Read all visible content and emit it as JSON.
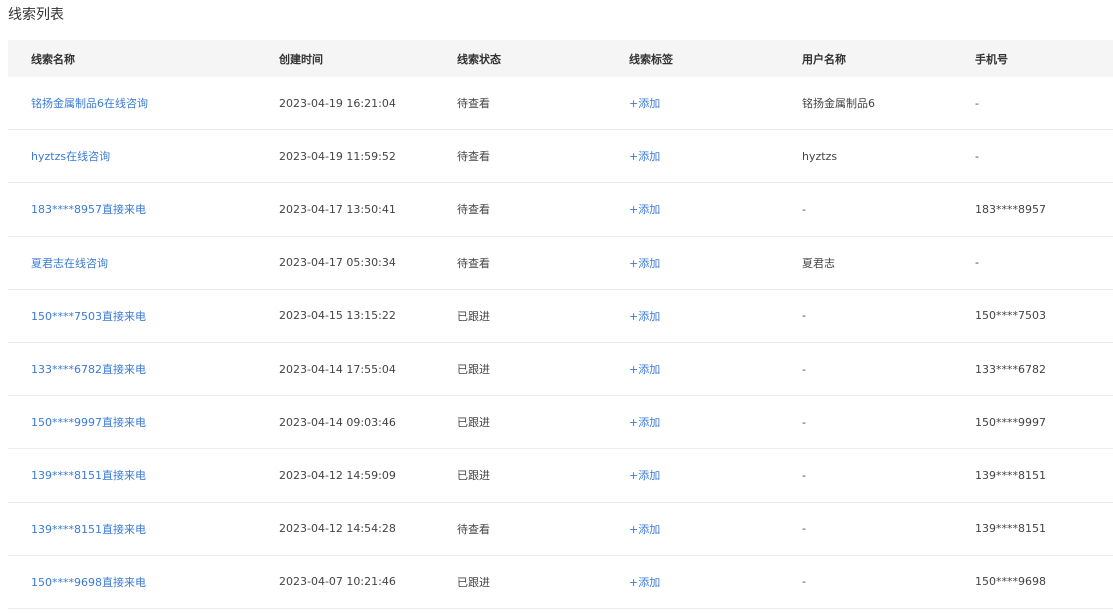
{
  "page": {
    "title": "线索列表"
  },
  "table": {
    "headers": [
      "线索名称",
      "创建时间",
      "线索状态",
      "线索标签",
      "用户名称",
      "手机号"
    ],
    "rows": [
      {
        "name": "铭扬金属制品6在线咨询",
        "created": "2023-04-19 16:21:04",
        "status": "待查看",
        "tag": "+添加",
        "user": "铭扬金属制品6",
        "phone": "-"
      },
      {
        "name": "hyztzs在线咨询",
        "created": "2023-04-19 11:59:52",
        "status": "待查看",
        "tag": "+添加",
        "user": "hyztzs",
        "phone": "-"
      },
      {
        "name": "183****8957直接来电",
        "created": "2023-04-17 13:50:41",
        "status": "待查看",
        "tag": "+添加",
        "user": "-",
        "phone": "183****8957"
      },
      {
        "name": "夏君志在线咨询",
        "created": "2023-04-17 05:30:34",
        "status": "待查看",
        "tag": "+添加",
        "user": "夏君志",
        "phone": "-"
      },
      {
        "name": "150****7503直接来电",
        "created": "2023-04-15 13:15:22",
        "status": "已跟进",
        "tag": "+添加",
        "user": "-",
        "phone": "150****7503"
      },
      {
        "name": "133****6782直接来电",
        "created": "2023-04-14 17:55:04",
        "status": "已跟进",
        "tag": "+添加",
        "user": "-",
        "phone": "133****6782"
      },
      {
        "name": "150****9997直接来电",
        "created": "2023-04-14 09:03:46",
        "status": "已跟进",
        "tag": "+添加",
        "user": "-",
        "phone": "150****9997"
      },
      {
        "name": "139****8151直接来电",
        "created": "2023-04-12 14:59:09",
        "status": "已跟进",
        "tag": "+添加",
        "user": "-",
        "phone": "139****8151"
      },
      {
        "name": "139****8151直接来电",
        "created": "2023-04-12 14:54:28",
        "status": "待查看",
        "tag": "+添加",
        "user": "-",
        "phone": "139****8151"
      },
      {
        "name": "150****9698直接来电",
        "created": "2023-04-07 10:21:46",
        "status": "已跟进",
        "tag": "+添加",
        "user": "-",
        "phone": "150****9698"
      }
    ]
  }
}
